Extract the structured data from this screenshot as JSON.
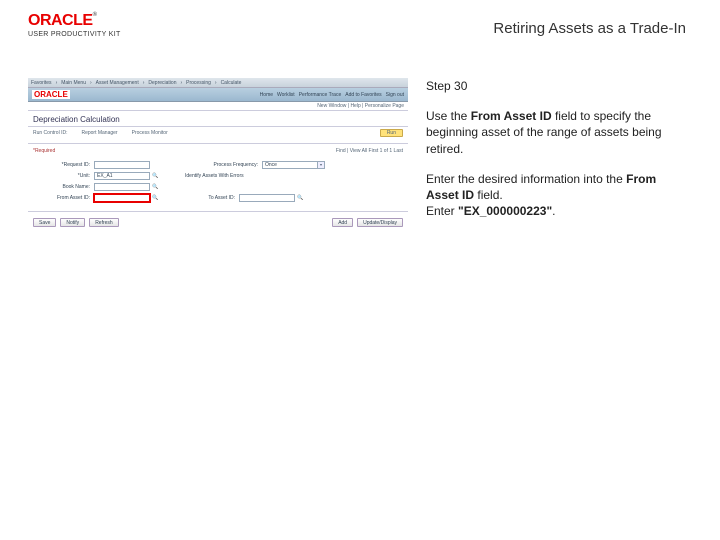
{
  "header": {
    "logo": "ORACLE",
    "logo_sub": "USER PRODUCTIVITY KIT",
    "title": "Retiring Assets as a Trade-In"
  },
  "instructions": {
    "step": "Step 30",
    "p1a": "Use the ",
    "p1b": "From Asset ID",
    "p1c": " field to specify the beginning asset of the range of assets being retired.",
    "p2a": "Enter the desired information into the ",
    "p2b": "From Asset ID",
    "p2c": " field.",
    "p3a": "Enter ",
    "p3b": "\"EX_000000223\"",
    "p3c": "."
  },
  "ss": {
    "crumb1": "Favorites",
    "crumb2": "Main Menu",
    "crumb3": "Asset Management",
    "crumb4": "Depreciation",
    "crumb5": "Processing",
    "crumb6": "Calculate",
    "nav1": "Home",
    "nav2": "Worklist",
    "nav3": "Performance Trace",
    "nav4": "Add to Favorites",
    "nav5": "Sign out",
    "subnav": "New Window | Help | Personalize Page",
    "page_title": "Depreciation Calculation",
    "lb_runctrl": "Run Control ID:",
    "lb_report": "Report Manager",
    "lb_procmon": "Process Monitor",
    "btn_run": "Run",
    "req_left": "*Required",
    "req_right": "Find | View All   First 1 of 1 Last",
    "row1_l1": "*Request ID:",
    "row1_l2": "Process Frequency:",
    "row1_v2": "Once",
    "row2_l1": "*Unit:",
    "row2_v1": "EX_A1",
    "row2_l2": "Identify Assets With Errors",
    "row3_l1": "Book Name:",
    "row4_l1": "From Asset ID:",
    "row4_l2": "To Asset ID:",
    "b_save": "Save",
    "b_notify": "Notify",
    "b_refresh": "Refresh",
    "b_add": "Add",
    "b_update": "Update/Display"
  }
}
